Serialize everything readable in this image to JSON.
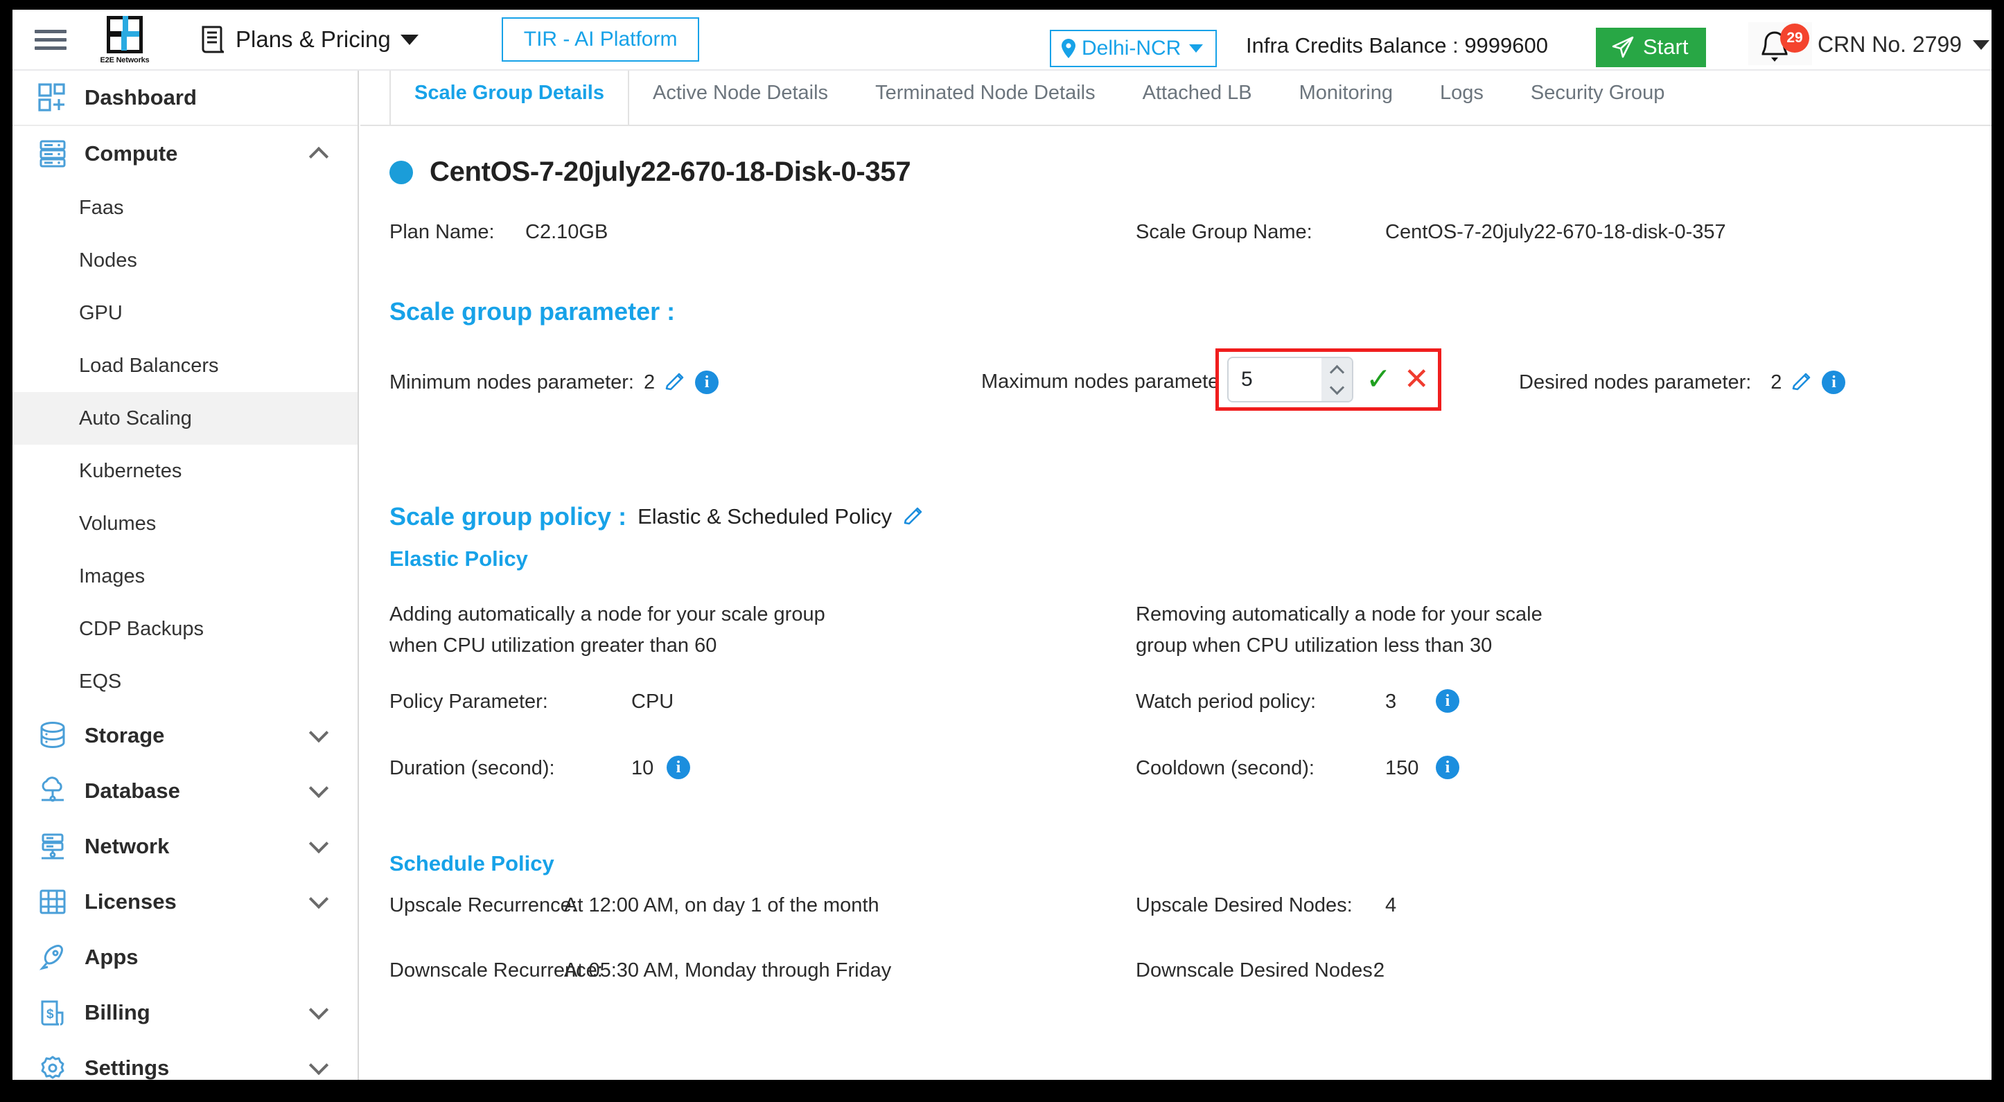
{
  "header": {
    "menu_icon": "hamburger-icon",
    "logo_text": "E2E Networks",
    "plans_label": "Plans & Pricing",
    "plans_icon": "receipt-icon",
    "tir_button": "TIR - AI Platform",
    "region": "Delhi-NCR",
    "region_icon": "location-pin-icon",
    "credits": "Infra Credits Balance : 9999600",
    "start_button": "Start",
    "start_icon": "send-icon",
    "bell_icon": "bell-icon",
    "notification_count": "29",
    "crn": "CRN No. 2799",
    "accent_blue": "#17a2e8",
    "start_green": "#28a745",
    "badge_red": "#f4442e"
  },
  "sidebar": {
    "items": [
      {
        "label": "Dashboard",
        "icon": "dashboard-grid-icon",
        "type": "top",
        "expandable": false
      },
      {
        "label": "Compute",
        "icon": "server-icon",
        "type": "top",
        "expandable": true,
        "expanded": true
      },
      {
        "label": "Faas",
        "type": "sub",
        "active": false
      },
      {
        "label": "Nodes",
        "type": "sub",
        "active": false
      },
      {
        "label": "GPU",
        "type": "sub",
        "active": false
      },
      {
        "label": "Load Balancers",
        "type": "sub",
        "active": false
      },
      {
        "label": "Auto Scaling",
        "type": "sub",
        "active": true
      },
      {
        "label": "Kubernetes",
        "type": "sub",
        "active": false
      },
      {
        "label": "Volumes",
        "type": "sub",
        "active": false
      },
      {
        "label": "Images",
        "type": "sub",
        "active": false
      },
      {
        "label": "CDP Backups",
        "type": "sub",
        "active": false
      },
      {
        "label": "EQS",
        "type": "sub",
        "active": false
      },
      {
        "label": "Storage",
        "icon": "database-stack-icon",
        "type": "top",
        "expandable": true,
        "expanded": false
      },
      {
        "label": "Database",
        "icon": "cloud-database-icon",
        "type": "top",
        "expandable": true,
        "expanded": false
      },
      {
        "label": "Network",
        "icon": "network-icon",
        "type": "top",
        "expandable": true,
        "expanded": false
      },
      {
        "label": "Licenses",
        "icon": "license-grid-icon",
        "type": "top",
        "expandable": true,
        "expanded": false
      },
      {
        "label": "Apps",
        "icon": "rocket-icon",
        "type": "top",
        "expandable": false
      },
      {
        "label": "Billing",
        "icon": "billing-receipt-icon",
        "type": "top",
        "expandable": true,
        "expanded": false
      },
      {
        "label": "Settings",
        "icon": "gear-icon",
        "type": "top",
        "expandable": true,
        "expanded": false
      }
    ]
  },
  "main": {
    "tabs": [
      {
        "label": "Scale Group Details",
        "active": true
      },
      {
        "label": "Active Node Details",
        "active": false
      },
      {
        "label": "Terminated Node Details",
        "active": false
      },
      {
        "label": "Attached LB",
        "active": false
      },
      {
        "label": "Monitoring",
        "active": false
      },
      {
        "label": "Logs",
        "active": false
      },
      {
        "label": "Security Group",
        "active": false
      }
    ],
    "page_title": "CentOS-7-20july22-670-18-Disk-0-357",
    "status_dot_color": "#1b9dd9",
    "plan_name_label": "Plan Name:",
    "plan_name_value": "C2.10GB",
    "scale_group_name_label": "Scale Group Name:",
    "scale_group_name_value": "CentOS-7-20july22-670-18-disk-0-357",
    "scale_group_parameter_heading": "Scale group parameter :",
    "min_nodes_label": "Minimum nodes parameter:",
    "min_nodes_value": "2",
    "max_nodes_label": "Maximum nodes parameter",
    "max_nodes_edit_value": "5",
    "confirm_glyph": "✓",
    "cancel_glyph": "✕",
    "desired_nodes_label": "Desired nodes parameter:",
    "desired_nodes_value": "2",
    "highlight_color": "#f01d1d",
    "scale_group_policy_heading": "Scale group policy :",
    "scale_group_policy_value": "Elastic & Scheduled Policy",
    "elastic_policy_heading": "Elastic Policy",
    "elastic_add_desc": "Adding automatically a node for your scale group when CPU utilization greater than 60",
    "elastic_remove_desc": "Removing automatically a node for your scale group when CPU utilization less than 30",
    "policy_parameter_label": "Policy Parameter:",
    "policy_parameter_value": "CPU",
    "watch_period_label": "Watch period policy:",
    "watch_period_value": "3",
    "duration_label": "Duration (second):",
    "duration_value": "10",
    "cooldown_label": "Cooldown (second):",
    "cooldown_value": "150",
    "schedule_policy_heading": "Schedule Policy",
    "upscale_recurrence_label": "Upscale Recurrence:",
    "upscale_recurrence_value": "At 12:00 AM, on day 1 of the month",
    "upscale_desired_label": "Upscale Desired Nodes:",
    "upscale_desired_value": "4",
    "downscale_recurrence_label": "Downscale Recurrence:",
    "downscale_recurrence_value": "At 05:30 AM, Monday through Friday",
    "downscale_desired_label": "Downscale Desired Nodes:",
    "downscale_desired_value": "2"
  }
}
